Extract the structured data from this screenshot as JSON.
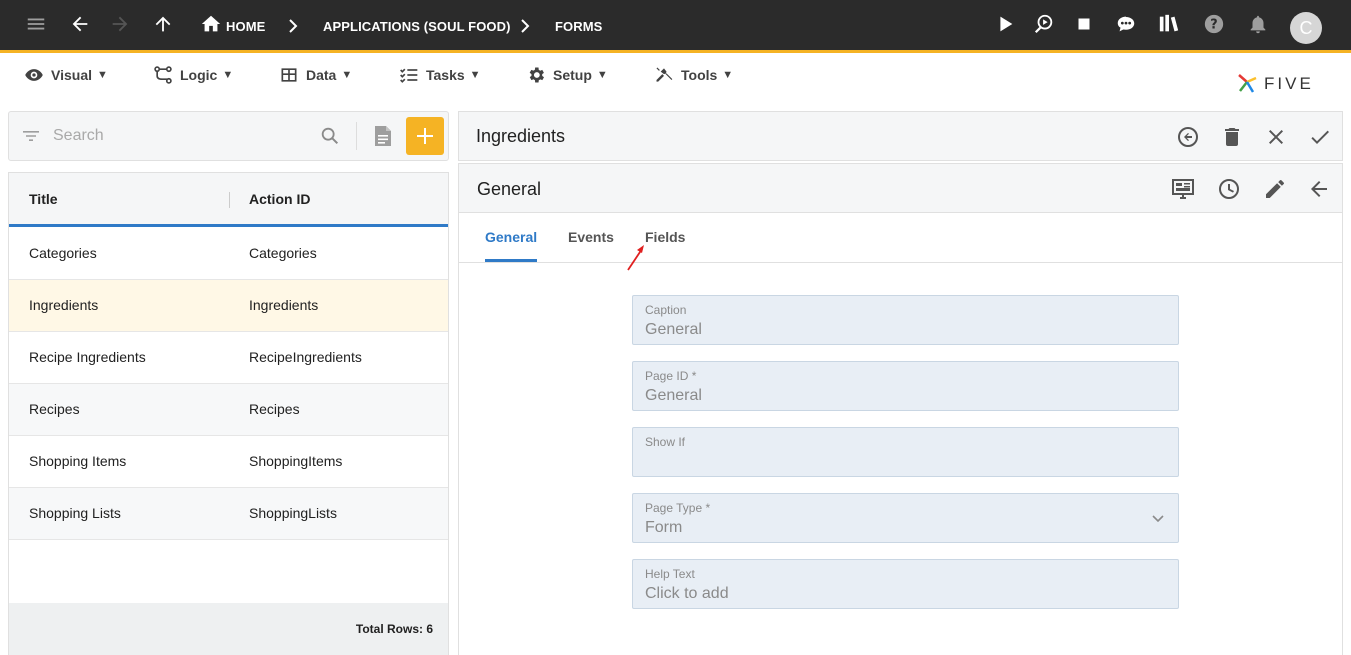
{
  "topbar": {
    "breadcrumbs": [
      "HOME",
      "APPLICATIONS (SOUL FOOD)",
      "FORMS"
    ],
    "avatar_initial": "C"
  },
  "menu": {
    "items": [
      {
        "label": "Visual",
        "icon": "eye-icon"
      },
      {
        "label": "Logic",
        "icon": "logic-icon"
      },
      {
        "label": "Data",
        "icon": "table-icon"
      },
      {
        "label": "Tasks",
        "icon": "checklist-icon"
      },
      {
        "label": "Setup",
        "icon": "gear-icon"
      },
      {
        "label": "Tools",
        "icon": "tools-icon"
      }
    ],
    "logo_text": "FIVE"
  },
  "search": {
    "placeholder": "Search"
  },
  "grid": {
    "columns": [
      "Title",
      "Action ID"
    ],
    "rows": [
      {
        "title": "Categories",
        "action_id": "Categories"
      },
      {
        "title": "Ingredients",
        "action_id": "Ingredients"
      },
      {
        "title": "Recipe Ingredients",
        "action_id": "RecipeIngredients"
      },
      {
        "title": "Recipes",
        "action_id": "Recipes"
      },
      {
        "title": "Shopping Items",
        "action_id": "ShoppingItems"
      },
      {
        "title": "Shopping Lists",
        "action_id": "ShoppingLists"
      }
    ],
    "selected_index": 1,
    "total_rows": "Total Rows: 6"
  },
  "form": {
    "title": "Ingredients",
    "page_title": "General",
    "tabs": [
      "General",
      "Events",
      "Fields"
    ],
    "active_tab": "General",
    "fields": [
      {
        "label": "Caption",
        "value": "General"
      },
      {
        "label": "Page ID *",
        "value": "General"
      },
      {
        "label": "Show If",
        "value": ""
      },
      {
        "label": "Page Type *",
        "value": "Form"
      },
      {
        "label": "Help Text",
        "value": "Click to add"
      }
    ]
  },
  "colors": {
    "topbar": "#2b2b2b",
    "accent": "#f5b324",
    "primary": "#2f7ac7",
    "annotation": "#e02020"
  }
}
